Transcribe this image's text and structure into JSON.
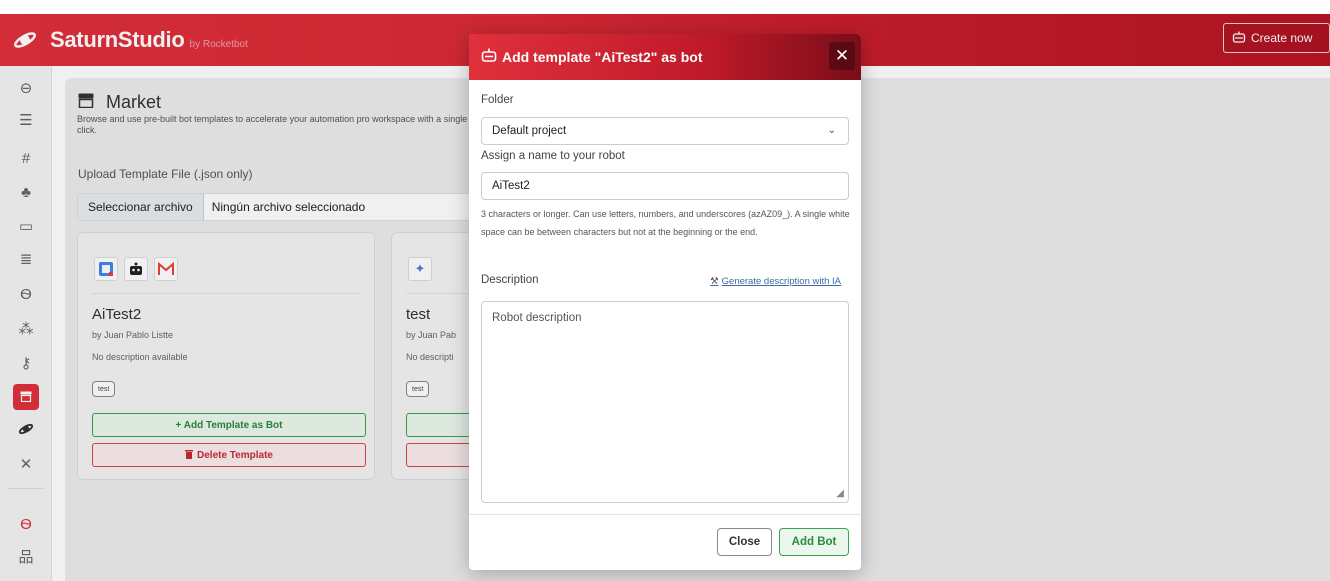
{
  "topbar": {
    "brand": "SaturnStudio",
    "brand_by": "by Rocketbot",
    "create_label": "Create now"
  },
  "sidebar": {
    "items": [
      {
        "icon": "robot-icon"
      },
      {
        "icon": "list-icon"
      },
      {
        "icon": "hashtag-icon"
      },
      {
        "icon": "cubes-icon"
      },
      {
        "icon": "window-icon"
      },
      {
        "icon": "database-icon"
      },
      {
        "icon": "users-icon"
      },
      {
        "icon": "sitemap-icon"
      },
      {
        "icon": "key-icon"
      },
      {
        "icon": "store-icon",
        "active": true
      },
      {
        "icon": "saturn-icon"
      },
      {
        "icon": "tools-icon"
      },
      {
        "icon": "user-group-icon"
      },
      {
        "icon": "hierarchy-icon"
      }
    ]
  },
  "market": {
    "title": "Market",
    "description": "Browse and use pre-built bot templates to accelerate your automation pro workspace with a single click.",
    "upload_label": "Upload Template File (.json only)",
    "file_button": "Seleccionar archivo",
    "file_status": "Ningún archivo seleccionado"
  },
  "cards": [
    {
      "name": "AiTest2",
      "author": "by Juan Pablo Listte",
      "description": "No description available",
      "tag": "test",
      "add_label": "+ Add Template as Bot",
      "delete_label": "Delete Template"
    },
    {
      "name": "test",
      "author": "by Juan Pab",
      "description": "No descripti",
      "tag": "test"
    }
  ],
  "modal": {
    "title": "Add template \"AiTest2\" as bot",
    "folder_label": "Folder",
    "folder_value": "Default project",
    "name_label": "Assign a name to your robot",
    "name_value": "AiTest2",
    "name_help": "3 characters or longer. Can use letters, numbers, and underscores (azAZ09_). A single white space can be between characters but not at the beginning or the end.",
    "description_label": "Description",
    "generate_label": "Generate description with IA",
    "description_placeholder": "Robot description",
    "close_label": "Close",
    "add_label": "Add Bot"
  },
  "colors": {
    "brand_red": "#e0303c",
    "success_green": "#37a54d",
    "danger_red": "#d6434f"
  }
}
